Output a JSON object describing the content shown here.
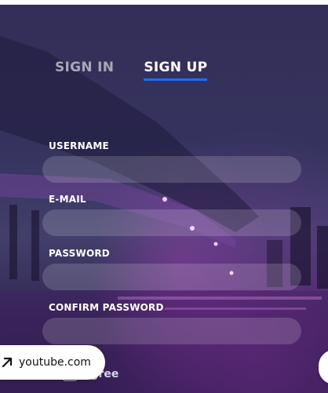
{
  "tabs": [
    {
      "label": "SIGN IN",
      "active": false
    },
    {
      "label": "SIGN UP",
      "active": true
    }
  ],
  "form": {
    "username": {
      "label": "USERNAME",
      "value": ""
    },
    "email": {
      "label": "E-MAIL",
      "value": ""
    },
    "password": {
      "label": "PASSWORD",
      "value": ""
    },
    "confirm_password": {
      "label": "CONFIRM PASSWORD",
      "value": ""
    }
  },
  "agree": {
    "label": "I agree",
    "visible_text": "agree",
    "checked": false
  },
  "overlay": {
    "link_text": "youtube.com",
    "icon": "external-arrow-icon"
  },
  "colors": {
    "accent": "#1f6ff0",
    "tab_inactive": "#a9a6b8",
    "text": "#ffffff"
  }
}
